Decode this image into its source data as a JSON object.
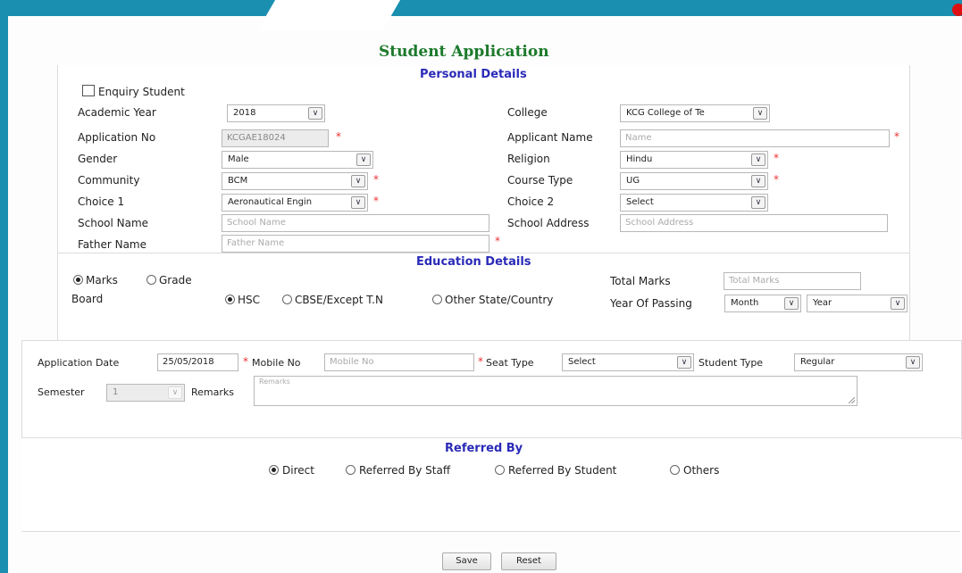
{
  "form": {
    "title": "Student Application"
  },
  "personal": {
    "heading": "Personal Details",
    "enquiry_label": "Enquiry Student",
    "academic_year": {
      "label": "Academic Year",
      "value": "2018"
    },
    "college": {
      "label": "College",
      "value": "KCG College of Te"
    },
    "application_no": {
      "label": "Application No",
      "value": "KCGAE18024",
      "req": "*"
    },
    "applicant_name": {
      "label": "Applicant Name",
      "placeholder": "Name",
      "req": "*"
    },
    "gender": {
      "label": "Gender",
      "value": "Male"
    },
    "religion": {
      "label": "Religion",
      "value": "Hindu",
      "req": "*"
    },
    "community": {
      "label": "Community",
      "value": "BCM",
      "req": "*"
    },
    "course_type": {
      "label": "Course Type",
      "value": "UG",
      "req": "*"
    },
    "choice1": {
      "label": "Choice 1",
      "value": "Aeronautical Engin",
      "req": "*"
    },
    "choice2": {
      "label": "Choice 2",
      "value": "Select"
    },
    "school_name": {
      "label": "School Name",
      "placeholder": "School Name"
    },
    "school_address": {
      "label": "School Address",
      "placeholder": "School Address"
    },
    "father_name": {
      "label": "Father Name",
      "placeholder": "Father Name",
      "req": "*"
    }
  },
  "education": {
    "heading": "Education Details",
    "mode_marks": "Marks",
    "mode_grade": "Grade",
    "board_label": "Board",
    "board_hsc": "HSC",
    "board_cbse": "CBSE/Except T.N",
    "board_other": "Other State/Country",
    "total_marks": {
      "label": "Total Marks",
      "placeholder": "Total Marks"
    },
    "year_of_passing": {
      "label": "Year Of Passing",
      "month": "Month",
      "year": "Year"
    }
  },
  "application": {
    "date": {
      "label": "Application Date",
      "value": "25/05/2018",
      "req": "*"
    },
    "mobile": {
      "label": "Mobile No",
      "placeholder": "Mobile No",
      "req": "*"
    },
    "seat_type": {
      "label": "Seat Type",
      "value": "Select"
    },
    "student_type": {
      "label": "Student Type",
      "value": "Regular"
    },
    "semester": {
      "label": "Semester",
      "value": "1"
    },
    "remarks": {
      "label": "Remarks",
      "placeholder": "Remarks"
    }
  },
  "referred": {
    "heading": "Referred By",
    "direct": "Direct",
    "staff": "Referred By Staff",
    "student": "Referred By Student",
    "others": "Others"
  },
  "buttons": {
    "save": "Save",
    "reset": "Reset"
  },
  "colors": {
    "topbar": "#1a8fb0",
    "title": "#1d7a2c",
    "section": "#2a2ab8",
    "required": "#e33"
  }
}
